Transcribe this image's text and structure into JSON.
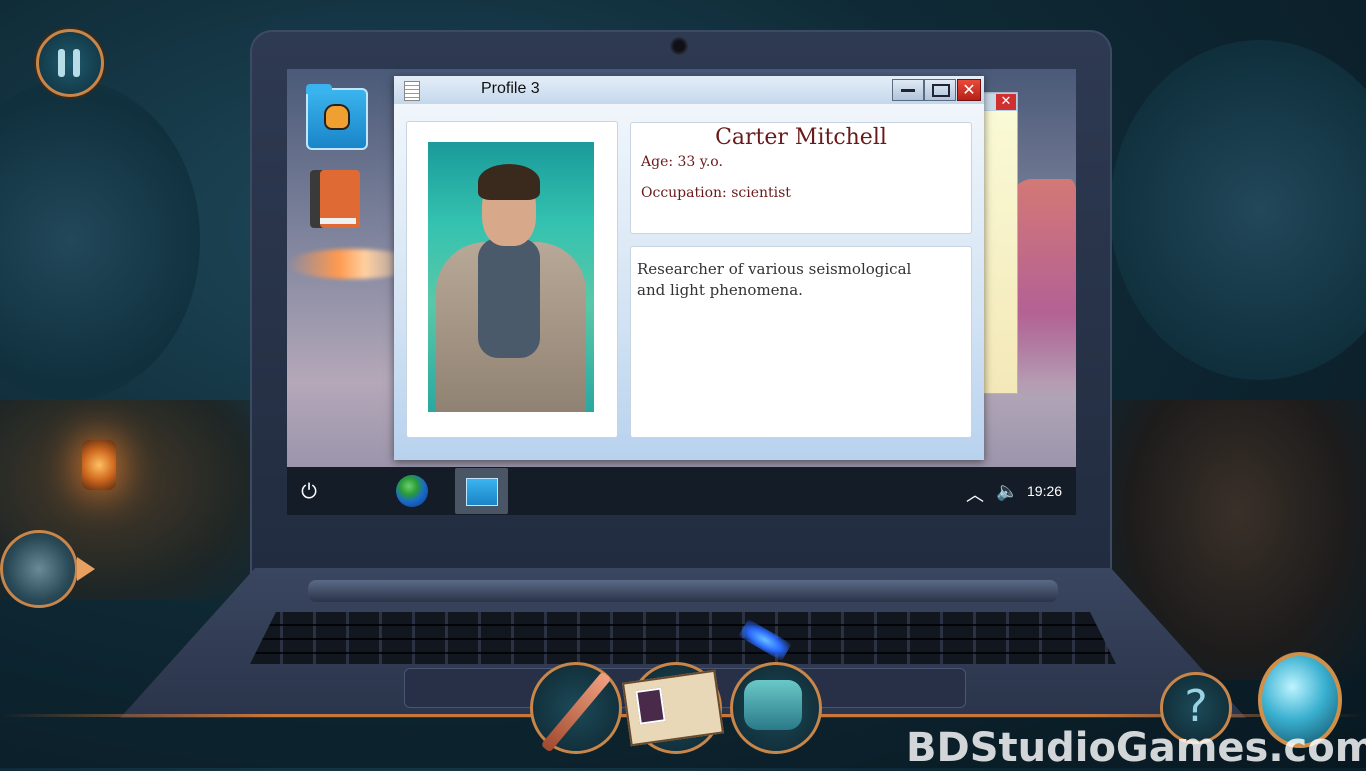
{
  "profile_window": {
    "title": "Profile 3",
    "name": "Carter Mitchell",
    "age": "Age: 33 y.o.",
    "occupation": "Occupation: scientist",
    "description": "Researcher of various seismological and light phenomena."
  },
  "taskbar": {
    "clock": "19:26"
  },
  "watermark": "BDStudioGames.com",
  "help_glyph": "?",
  "close_glyph": "✕"
}
